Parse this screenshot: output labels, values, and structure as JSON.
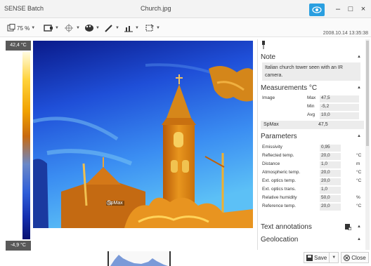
{
  "titlebar": {
    "app_name": "SENSE Batch",
    "document": "Church.jpg",
    "minimize": "–",
    "maximize": "□",
    "close": "×"
  },
  "toolbar": {
    "zoom": "75 %",
    "timestamp": "2008.10.14 13:35:38"
  },
  "scale": {
    "max_label": "42,4 °C",
    "min_label": "-4,9 °C"
  },
  "thermal": {
    "spot_label": "SpMax"
  },
  "panel": {
    "note": {
      "title": "Note",
      "text": "Italian church tower seen with an IR camera."
    },
    "measurements": {
      "title": "Measurements °C",
      "group": "Image",
      "rows": [
        {
          "label": "Max",
          "value": "47,5"
        },
        {
          "label": "Min",
          "value": "-5,2"
        },
        {
          "label": "Avg",
          "value": "10,0"
        }
      ],
      "spot": {
        "label": "SpMax",
        "value": "47,5"
      }
    },
    "parameters": {
      "title": "Parameters",
      "rows": [
        {
          "label": "Emissivity",
          "value": "0,95",
          "unit": ""
        },
        {
          "label": "Reflected temp.",
          "value": "20,0",
          "unit": "°C"
        },
        {
          "label": "Distance",
          "value": "1,0",
          "unit": "m"
        },
        {
          "label": "Atmospheric temp.",
          "value": "20,0",
          "unit": "°C"
        },
        {
          "label": "Ext. optics temp.",
          "value": "20,0",
          "unit": "°C"
        },
        {
          "label": "Ext. optics trans.",
          "value": "1,0",
          "unit": ""
        },
        {
          "label": "Relative humidity",
          "value": "50,0",
          "unit": "%"
        },
        {
          "label": "Reference temp.",
          "value": "20,0",
          "unit": "°C"
        }
      ]
    },
    "text_annotations": {
      "title": "Text annotations"
    },
    "geolocation": {
      "title": "Geolocation"
    }
  },
  "footer": {
    "save": "Save",
    "close": "Close"
  },
  "colors": {
    "accent": "#2a9fe0",
    "scale_label_bg": "#595959"
  }
}
